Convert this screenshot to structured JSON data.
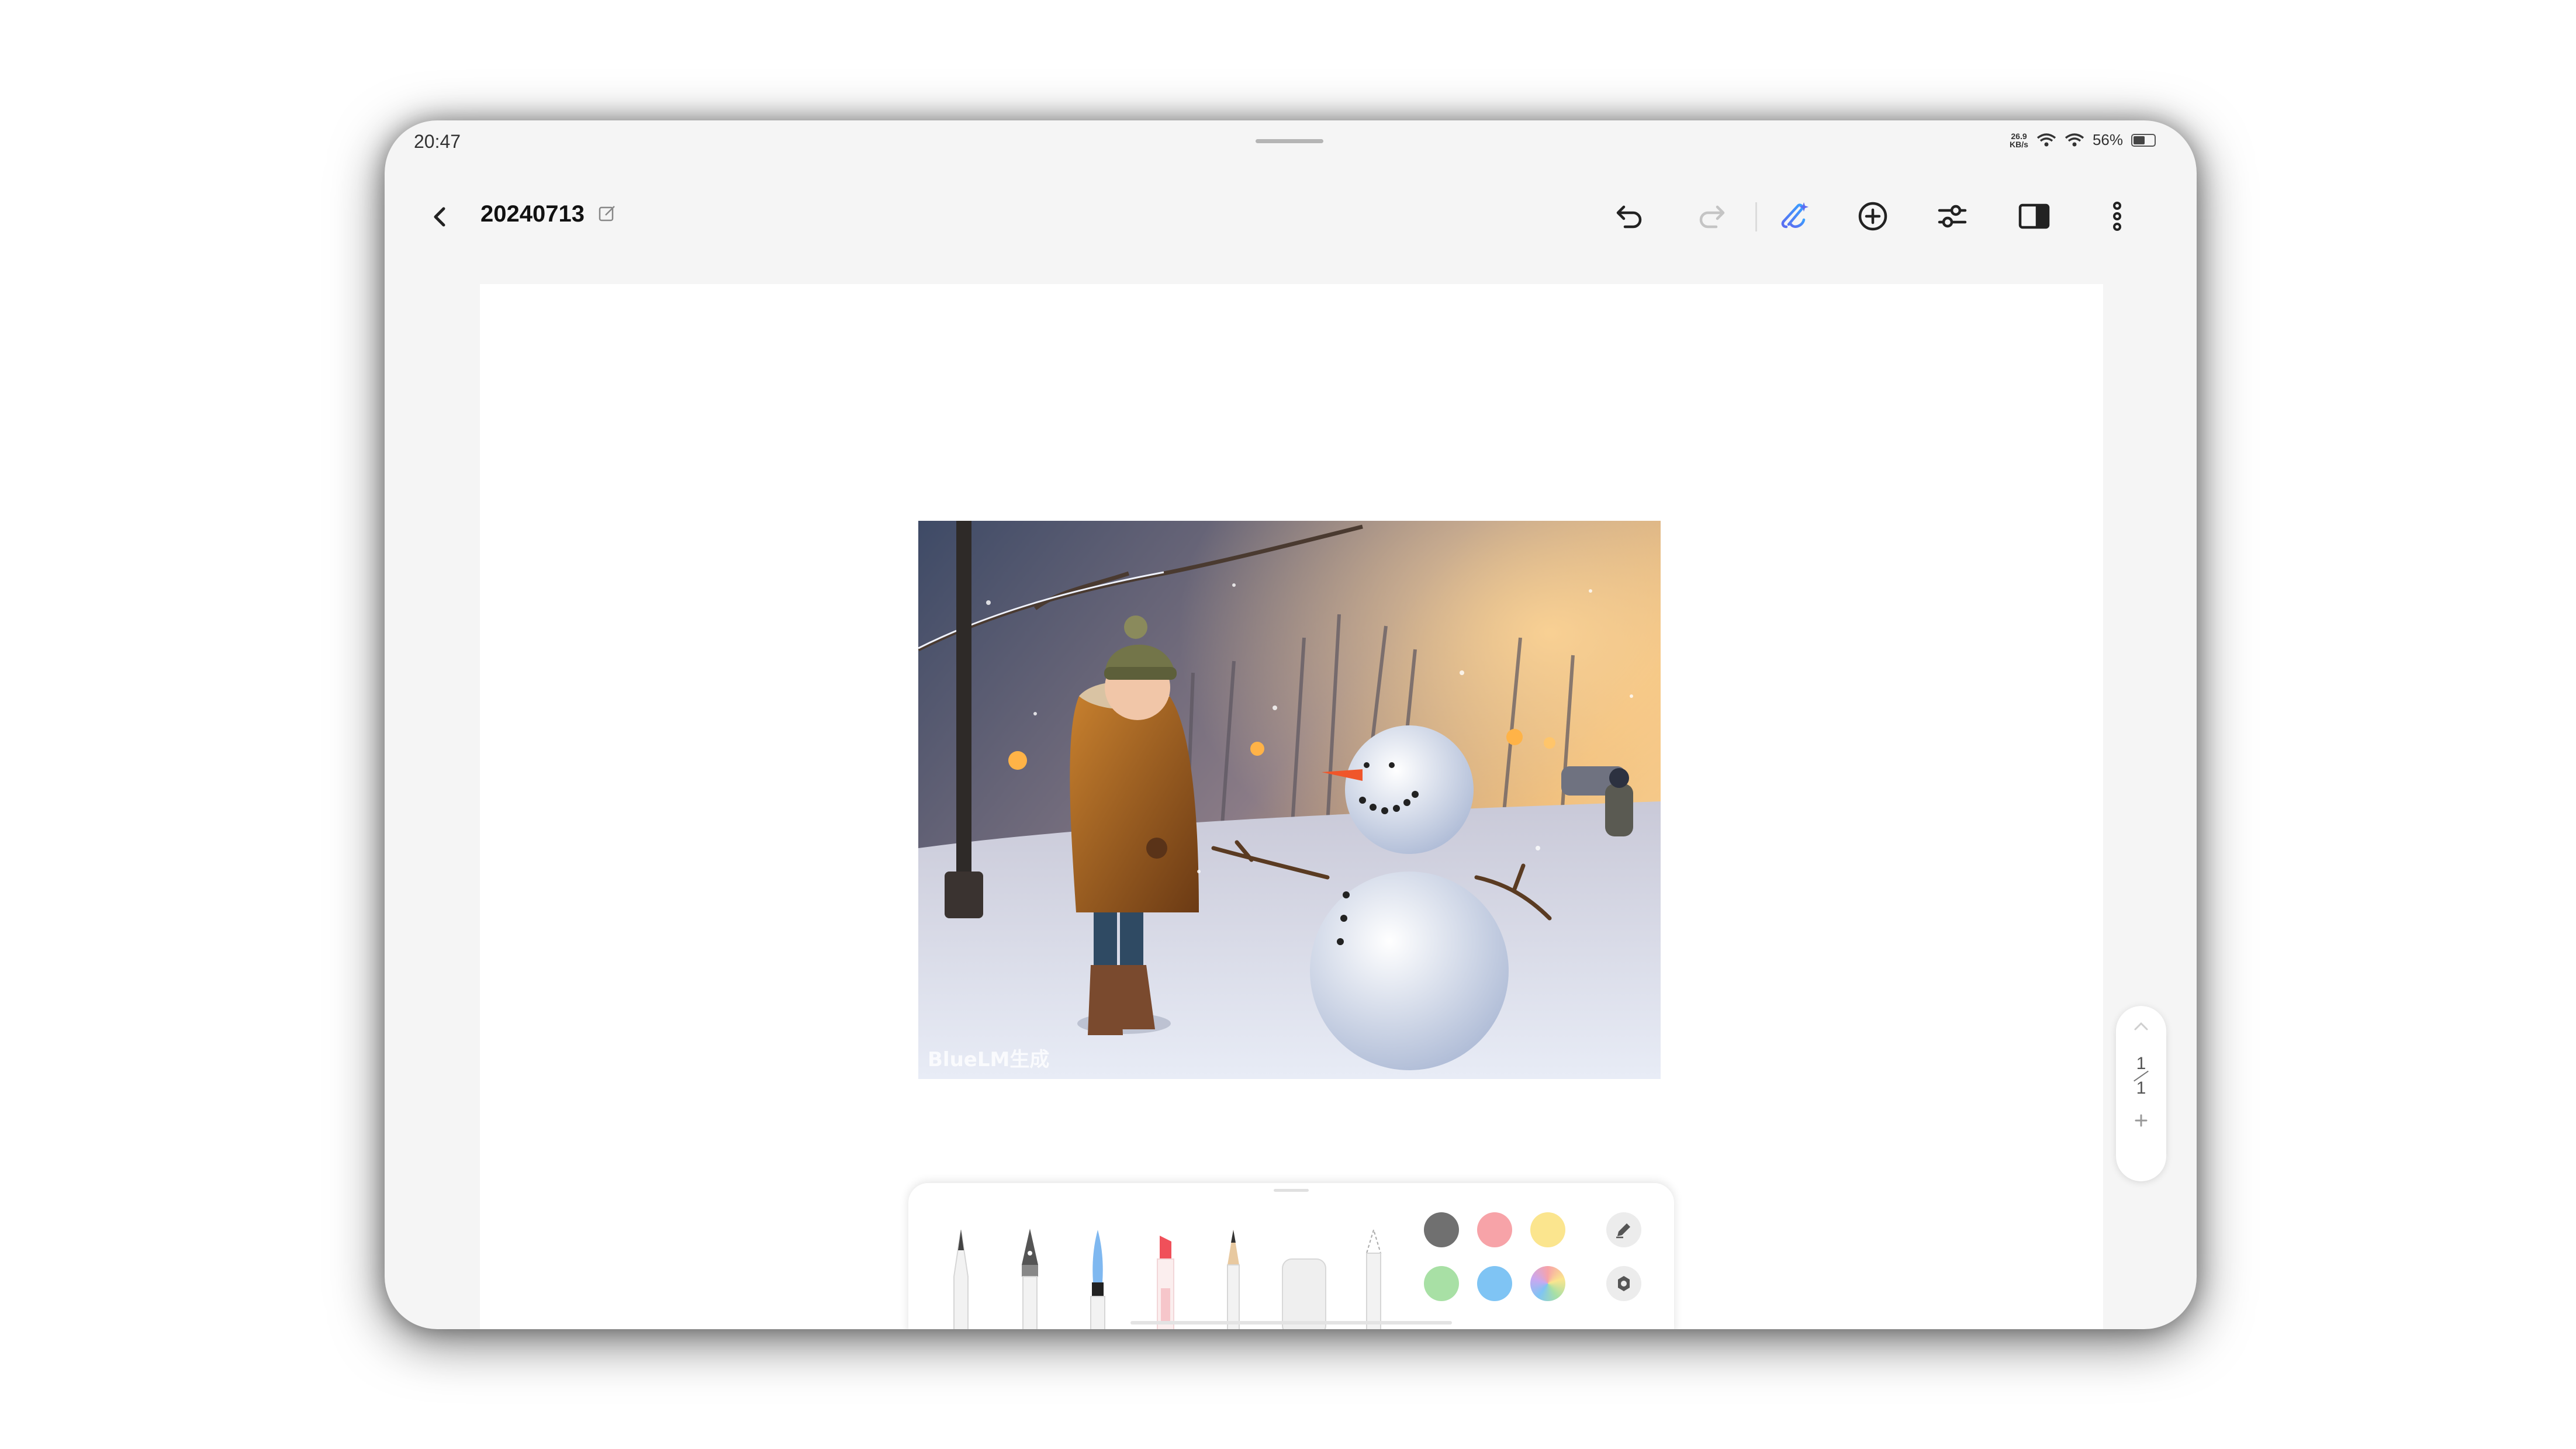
{
  "status_bar": {
    "time": "20:47",
    "net_speed_value": "26.9",
    "net_speed_unit": "KB/s",
    "battery_percent": "56%",
    "battery_level": 0.56
  },
  "toolbar": {
    "title": "20240713",
    "icons": [
      "back-icon",
      "edit-icon",
      "undo-icon",
      "redo-icon",
      "ai-brush-icon",
      "add-circle-icon",
      "sliders-icon",
      "split-view-icon",
      "more-icon"
    ]
  },
  "canvas": {
    "image_watermark": "BlueLM生成"
  },
  "page_indicator": {
    "current": "1",
    "total": "1"
  },
  "pen_tray": {
    "tools": [
      "ballpoint-pen",
      "fountain-pen",
      "brush-pen",
      "highlighter",
      "pencil",
      "eraser",
      "lasso-tool"
    ],
    "colors": [
      "#707070",
      "#f7a3a8",
      "#fbe58e",
      "#a8e0a5",
      "#7fc4f4",
      "rainbow"
    ]
  }
}
